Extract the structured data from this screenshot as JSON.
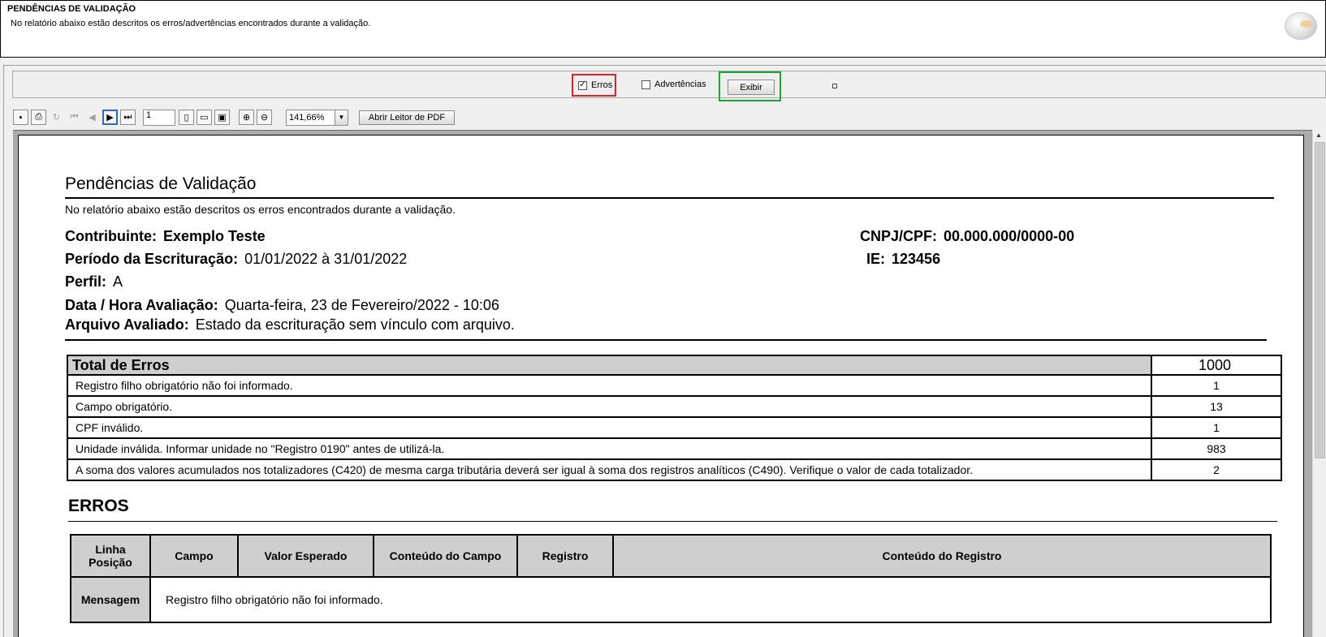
{
  "header": {
    "title": "PENDÊNCIAS DE VALIDAÇÃO",
    "subtitle": "No relatório abaixo estão descritos os erros/advertências encontrados durante a validação."
  },
  "filters": {
    "erros_label": "Erros",
    "erros_checked": true,
    "advertencias_label": "Advertências",
    "advertencias_checked": false,
    "exibir_label": "Exibir"
  },
  "toolbar": {
    "page_value": "1",
    "zoom_value": "141,66%",
    "pdf_button_label": "Abrir Leitor de PDF"
  },
  "report": {
    "title": "Pendências de Validação",
    "subtitle": "No relatório abaixo estão descritos os erros encontrados durante a validação.",
    "contribuinte_label": "Contribuinte:",
    "contribuinte_value": "Exemplo Teste",
    "periodo_label": "Período da Escrituração:",
    "periodo_value": "01/01/2022 à  31/01/2022",
    "perfil_label": "Perfil:",
    "perfil_value": "A",
    "data_label": "Data / Hora Avaliação:",
    "data_value": "Quarta-feira, 23 de Fevereiro/2022 - 10:06",
    "arquivo_label": "Arquivo Avaliado:",
    "arquivo_value": "Estado da escrituração sem vínculo com arquivo.",
    "cnpj_label": "CNPJ/CPF:",
    "cnpj_value": "00.000.000/0000-00",
    "ie_label": "IE:",
    "ie_value": "123456",
    "totals": {
      "header_label": "Total de Erros",
      "header_value": "1000",
      "rows": [
        {
          "label": "Registro filho obrigatório não foi informado.",
          "value": "1"
        },
        {
          "label": "Campo obrigatório.",
          "value": "13"
        },
        {
          "label": "CPF inválido.",
          "value": "1"
        },
        {
          "label": "Unidade inválida. Informar unidade no \"Registro 0190\" antes de utilizá-la.",
          "value": "983"
        },
        {
          "label": "A soma dos valores acumulados nos totalizadores (C420) de mesma carga tributária deverá ser igual à soma dos registros analíticos (C490). Verifique o valor de cada totalizador.",
          "value": "2"
        }
      ]
    },
    "erros_title": "ERROS",
    "erros_table": {
      "col_linha_1": "Linha",
      "col_linha_2": "Posição",
      "col_campo": "Campo",
      "col_valor": "Valor Esperado",
      "col_conteudo_campo": "Conteúdo do Campo",
      "col_registro": "Registro",
      "col_conteudo_registro": "Conteúdo do Registro",
      "mensagem_label": "Mensagem",
      "mensagem_value": "Registro filho obrigatório não foi informado."
    }
  }
}
